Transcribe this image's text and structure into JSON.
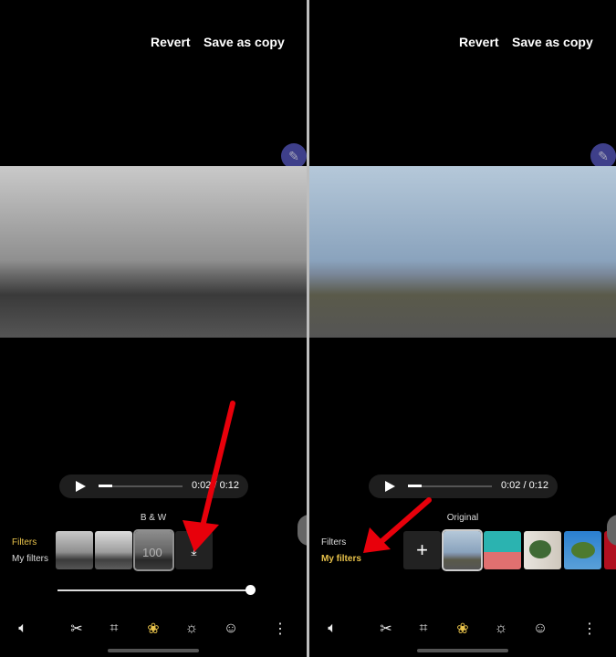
{
  "panels": [
    {
      "revert": "Revert",
      "save_copy": "Save as copy",
      "time": "0:02 / 0:12",
      "filter_label": "B & W",
      "tabs": [
        "Filters",
        "My filters"
      ],
      "active_tab": "Filters",
      "intensity": "100",
      "slider_value": 100
    },
    {
      "revert": "Revert",
      "save_copy": "Save as copy",
      "time": "0:02 / 0:12",
      "filter_label": "Original",
      "tabs": [
        "Filters",
        "My filters"
      ],
      "active_tab": "My filters"
    }
  ],
  "colors": {
    "accent": "#e8c24a",
    "arrow": "#e8000b"
  },
  "toolbar_icons": [
    "volume-icon",
    "scissors-icon",
    "crop-rotate-icon",
    "filters-icon",
    "brightness-icon",
    "sticker-icon",
    "more-icon"
  ]
}
